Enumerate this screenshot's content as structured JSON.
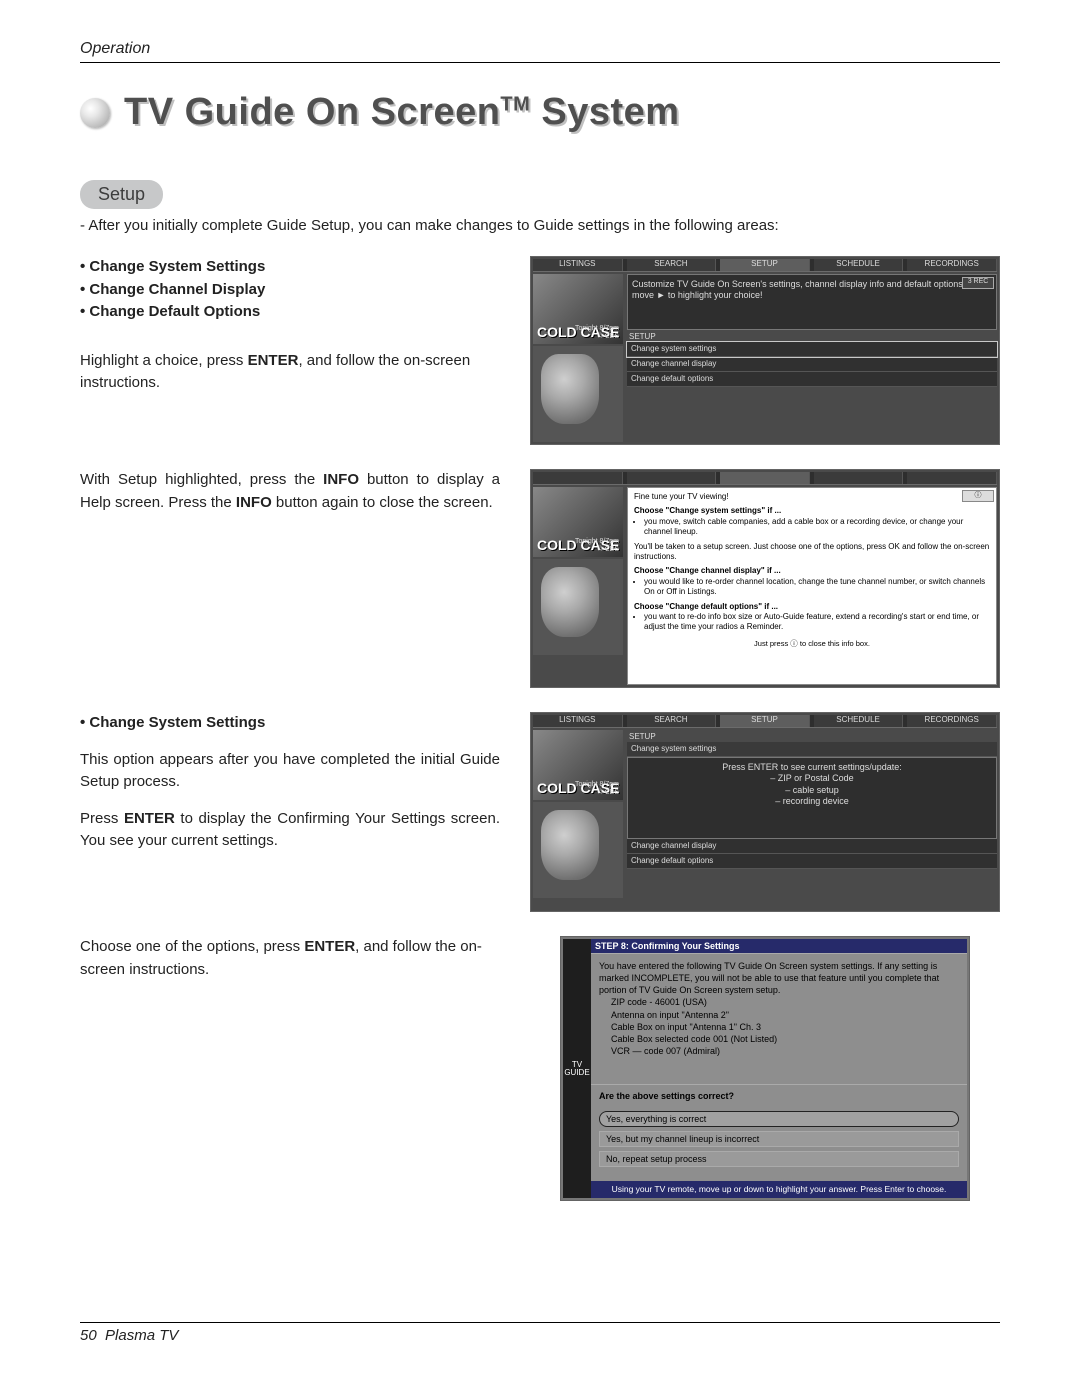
{
  "header": {
    "section": "Operation"
  },
  "title": {
    "main": "TV Guide On Screen",
    "tm": "TM",
    "tail": " System"
  },
  "setup": {
    "pill": "Setup",
    "intro": "-  After you initially complete Guide Setup, you can make changes to Guide settings in the following areas:"
  },
  "bullets": [
    "Change System Settings",
    "Change Channel Display",
    "Change Default Options"
  ],
  "para1a": "Highlight a choice, press ",
  "para1b": "ENTER",
  "para1c": ", and follow the on-screen instructions.",
  "para2a": "With Setup highlighted, press the ",
  "para2b": "INFO",
  "para2c": " button to display a Help screen. Press the ",
  "para2d": "INFO",
  "para2e": " button again to close the screen.",
  "css_head": "• Change System Settings",
  "css_p1": "This option appears after you have completed the initial Guide Setup process.",
  "css_p2a": "Press ",
  "css_p2b": "ENTER",
  "css_p2c": " to display the Confirming Your Settings screen. You see your current settings.",
  "para4a": "Choose one of the options, press ",
  "para4b": "ENTER",
  "para4c": ", and follow the on-screen instructions.",
  "footer": {
    "page": "50",
    "product": "Plasma TV"
  },
  "fig": {
    "tabs": [
      "LISTINGS",
      "SEARCH",
      "SETUP",
      "SCHEDULE",
      "RECORDINGS"
    ],
    "show_title": "COLD CASE",
    "show_sub1": "Tonight 8/7pm",
    "show_sub2": "© CBS",
    "hint1": "Customize TV Guide On Screen's settings, channel display info and default options. Just move ► to highlight your choice!",
    "badge": "3 REC",
    "crumb": "SETUP",
    "opt1": "Change system settings",
    "opt2": "Change channel display",
    "opt3": "Change default options"
  },
  "fig2": {
    "intro": "Fine tune your TV viewing!",
    "h1": "Choose \"Change system settings\" if ...",
    "h1b": [
      "you move, switch cable companies, add a cable box or a recording device, or change your channel lineup."
    ],
    "mid": "You'll be taken to a setup screen. Just choose one of the options, press OK and follow the on-screen instructions.",
    "h2": "Choose \"Change channel display\" if ...",
    "h2b": [
      "you would like to re-order channel location, change the tune channel number, or switch channels On or Off in Listings."
    ],
    "h3": "Choose \"Change default options\" if ...",
    "h3b": [
      "you want to re-do info box size or Auto-Guide feature, extend a recording's start or end time, or adjust the time your radios a Reminder."
    ],
    "ft": "Just press ⓘ to close this info box."
  },
  "fig3": {
    "crumb": "SETUP",
    "row_sel": "Change system settings",
    "desc_head": "Press ENTER to see current settings/update:",
    "desc_items": [
      "– ZIP or Postal Code",
      "– cable setup",
      "– recording device"
    ],
    "row2": "Change channel display",
    "row3": "Change default options"
  },
  "fig4": {
    "titlebar": "STEP 8: Confirming Your Settings",
    "desc1": "You have entered the following TV Guide On Screen system settings. If any setting is marked INCOMPLETE, you will not be able to use that feature until you complete that portion of TV Guide On Screen system setup.",
    "lines": [
      "ZIP code - 46001 (USA)",
      "Antenna on input \"Antenna 2\"",
      "Cable Box on input \"Antenna 1\" Ch. 3",
      "Cable Box selected code 001 (Not Listed)",
      "VCR — code 007 (Admiral)"
    ],
    "question": "Are the above settings correct?",
    "answers": [
      "Yes, everything is correct",
      "Yes, but my channel lineup is incorrect",
      "No, repeat setup process"
    ],
    "hint": "Using your TV remote, move up or down to highlight your answer. Press Enter to choose."
  }
}
